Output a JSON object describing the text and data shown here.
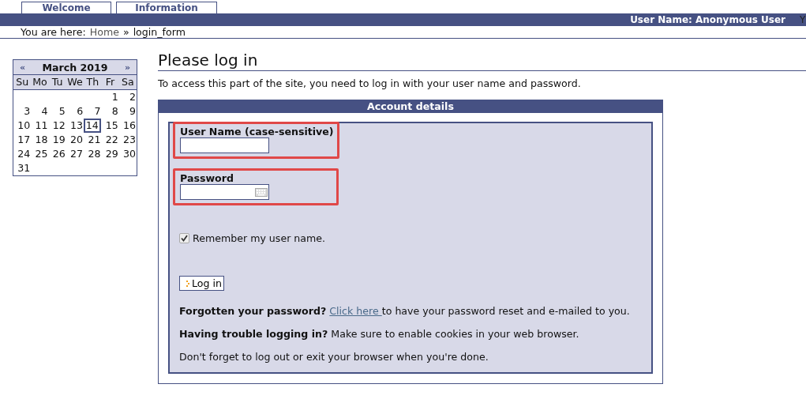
{
  "tabs": [
    {
      "label": "Welcome",
      "selected": false
    },
    {
      "label": "Information",
      "selected": false
    }
  ],
  "header": {
    "user": "User Name: Anonymous User",
    "cut_text": "Y"
  },
  "breadcrumb": {
    "prefix": "You are here:",
    "home": "Home",
    "separator": "»",
    "current": "login_form"
  },
  "calendar": {
    "prev": "«",
    "title": "March 2019",
    "next": "»",
    "weekdays": [
      "Su",
      "Mo",
      "Tu",
      "We",
      "Th",
      "Fr",
      "Sa"
    ],
    "weeks": [
      [
        {
          "day": "1",
          "selected": false
        },
        {
          "day": "2",
          "selected": false
        }
      ],
      [
        {
          "day": "3",
          "selected": false
        },
        {
          "day": "4",
          "selected": false
        },
        {
          "day": "5",
          "selected": false
        },
        {
          "day": "6",
          "selected": false
        },
        {
          "day": "7",
          "selected": false
        },
        {
          "day": "8",
          "selected": false
        },
        {
          "day": "9",
          "selected": false
        }
      ],
      [
        {
          "day": "10",
          "selected": false
        },
        {
          "day": "11",
          "selected": false
        },
        {
          "day": "12",
          "selected": false
        },
        {
          "day": "13",
          "selected": false
        },
        {
          "day": "14",
          "selected": true
        },
        {
          "day": "15",
          "selected": false
        },
        {
          "day": "16",
          "selected": false
        }
      ],
      [
        {
          "day": "17",
          "selected": false
        },
        {
          "day": "18",
          "selected": false
        },
        {
          "day": "19",
          "selected": false
        },
        {
          "day": "20",
          "selected": false
        },
        {
          "day": "21",
          "selected": false
        },
        {
          "day": "22",
          "selected": false
        },
        {
          "day": "23",
          "selected": false
        }
      ],
      [
        {
          "day": "24",
          "selected": false
        },
        {
          "day": "25",
          "selected": false
        },
        {
          "day": "26",
          "selected": false
        },
        {
          "day": "27",
          "selected": false
        },
        {
          "day": "28",
          "selected": false
        },
        {
          "day": "29",
          "selected": false
        },
        {
          "day": "30",
          "selected": false
        }
      ],
      [
        {
          "day": "31",
          "selected": false
        }
      ]
    ]
  },
  "page": {
    "title": "Please log in",
    "intro": "To access this part of the site, you need to log in with your user name and password."
  },
  "form": {
    "legend": "Account details",
    "fields": [
      {
        "label": "User Name (case-sensitive)",
        "kind": "text",
        "highlighted": true
      },
      {
        "label": "Password",
        "kind": "password",
        "highlighted": true
      }
    ],
    "remember": {
      "label": "Remember my user name.",
      "checked": true
    },
    "button": "Log in",
    "notes": [
      {
        "text": "**Forgotten your password?** ",
        "link": "Click here ",
        "rest": "to have your password reset and e-mailed to you."
      },
      {
        "text": "**Having trouble logging in?** Make sure to enable cookies in your web browser."
      },
      {
        "text": "Don't forget to log out or exit your browser when you're done."
      }
    ]
  }
}
